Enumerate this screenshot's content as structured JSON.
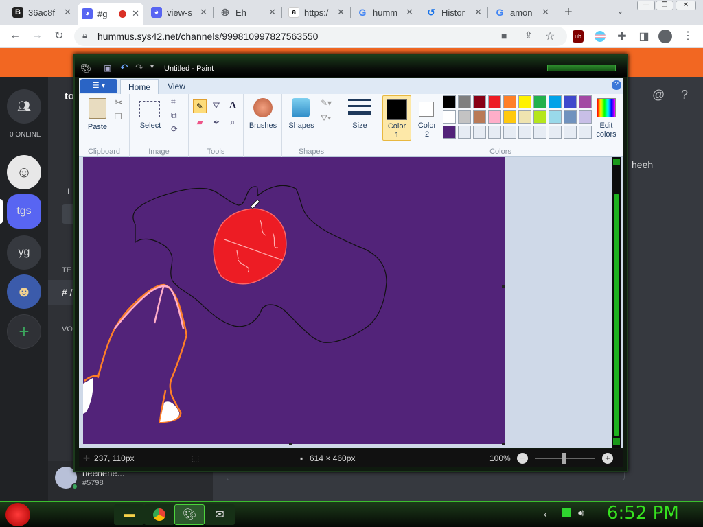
{
  "browser": {
    "tabs": [
      {
        "label": "36ac8f",
        "icon": "b-logo-icon"
      },
      {
        "label": "#g",
        "icon": "discord-icon",
        "active": true
      },
      {
        "label": "view-s",
        "icon": "discord-icon"
      },
      {
        "label": "Eh",
        "icon": "globe-icon"
      },
      {
        "label": "https:/",
        "icon": "amazon-icon"
      },
      {
        "label": "humm",
        "icon": "google-icon"
      },
      {
        "label": "Histor",
        "icon": "history-icon"
      },
      {
        "label": "amon",
        "icon": "google-icon"
      }
    ],
    "new_tab_symbol": "+",
    "url": "hummus.sys42.net/channels/999810997827563550"
  },
  "discord": {
    "online_label": "0 ONLINE",
    "servers": [
      {
        "label": "tgs"
      },
      {
        "label": "yg"
      }
    ],
    "channel_prefix_letter": "to",
    "channel_hash": "# /",
    "text_header": "TE",
    "voice_header": "VO",
    "l_label": "L",
    "chat_message": "heeh",
    "username": "heehehe...",
    "discriminator": "#5798"
  },
  "paint": {
    "title": "Untitled - Paint",
    "tabs": [
      "Home",
      "View"
    ],
    "groups": {
      "clipboard": "Clipboard",
      "image": "Image",
      "tools": "Tools",
      "shapes": "Shapes",
      "colors": "Colors"
    },
    "buttons": {
      "paste": "Paste",
      "select": "Select",
      "brushes": "Brushes",
      "shapes": "Shapes",
      "size": "Size",
      "color1_a": "Color",
      "color1_b": "1",
      "color2_a": "Color",
      "color2_b": "2",
      "edit_a": "Edit",
      "edit_b": "colors"
    },
    "palette_row1": [
      "#000000",
      "#7f7f7f",
      "#880015",
      "#ed1c24",
      "#ff7f27",
      "#fff200",
      "#22b14c",
      "#00a2e8",
      "#3f48cc",
      "#a349a4"
    ],
    "palette_row2": [
      "#ffffff",
      "#c3c3c3",
      "#b97a57",
      "#ffaec9",
      "#ffc90e",
      "#efe4b0",
      "#b5e61d",
      "#99d9ea",
      "#7092be",
      "#c8bfe7"
    ],
    "palette_row3": [
      "#522379",
      "#e6ecf4",
      "#e6ecf4",
      "#e6ecf4",
      "#e6ecf4",
      "#e6ecf4",
      "#e6ecf4",
      "#e6ecf4",
      "#e6ecf4",
      "#e6ecf4"
    ],
    "color1": "#000000",
    "color2": "#ffffff",
    "canvas_color": "#522379",
    "status": {
      "cursor_pos": "237, 110px",
      "canvas_size": "614 × 460px",
      "zoom": "100%"
    }
  },
  "taskbar": {
    "clock": "6:52 PM"
  }
}
